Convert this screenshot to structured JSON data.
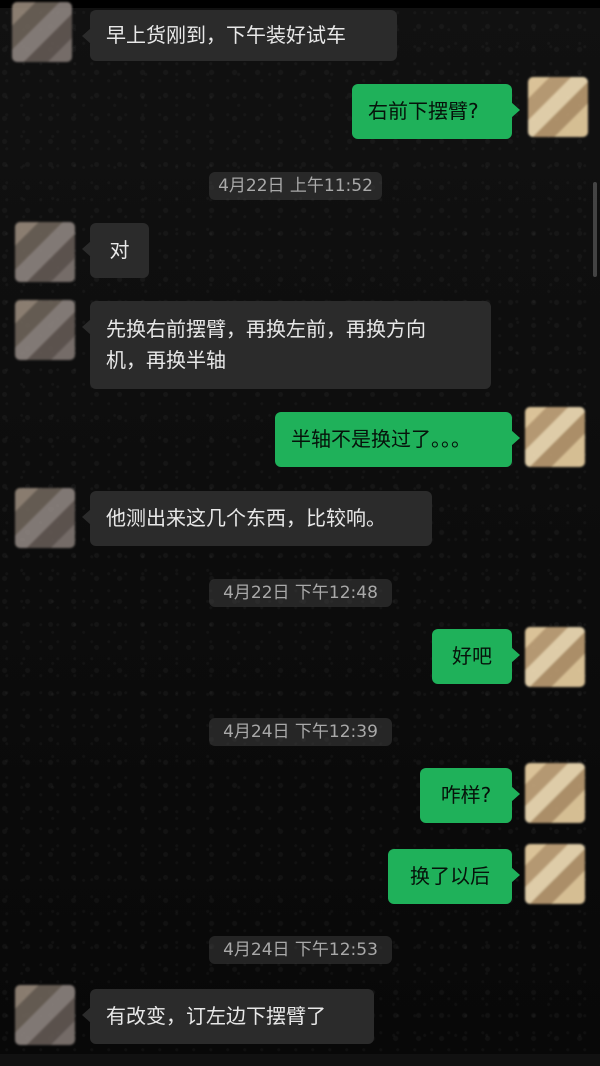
{
  "messages": {
    "m1": "早上货刚到，下午装好试车",
    "m2": "右前下摆臂?",
    "m3": "对",
    "m4": "先换右前摆臂，再换左前，再换方向\n机，再换半轴",
    "m5": "半轴不是换过了。。。",
    "m6": "他测出来这几个东西，比较响。",
    "m7": "好吧",
    "m8": "咋样?",
    "m9": "换了以后",
    "m10": "有改变，订左边下摆臂了"
  },
  "timestamps": {
    "t1": "4月22日 上午11:52",
    "t2": "4月22日 下午12:48",
    "t3": "4月24日 下午12:39",
    "t4": "4月24日 下午12:53"
  },
  "colors": {
    "background": "#0b0b0b",
    "incoming_bubble": "#2b2b2b",
    "outgoing_bubble": "#1fb15a",
    "timestamp_bg": "#484848"
  }
}
